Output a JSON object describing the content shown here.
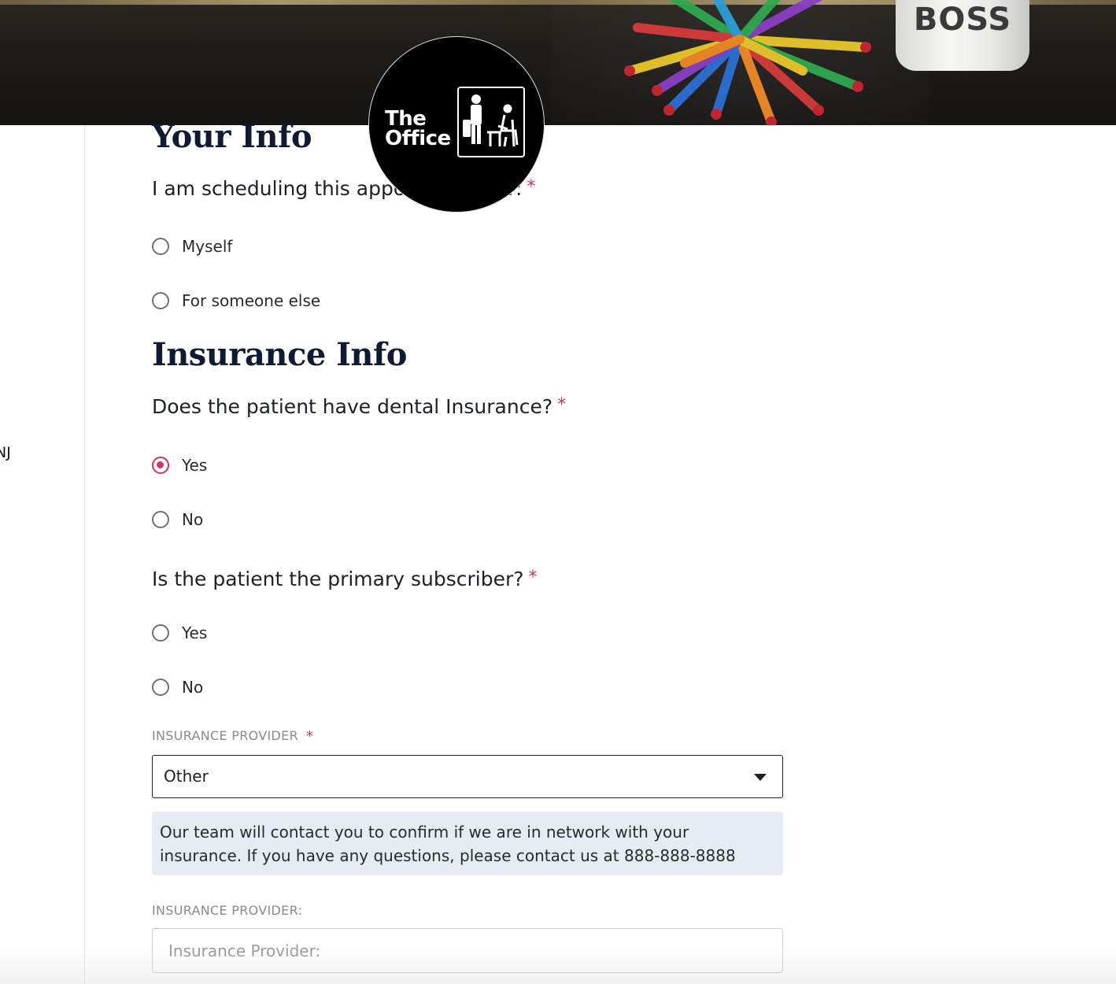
{
  "banner": {
    "mug_text": "BOSS"
  },
  "logo": {
    "line1": "The",
    "line2": "Office"
  },
  "sidebar": {
    "partial_text": "NJ"
  },
  "your_info": {
    "heading": "Your Info",
    "question": "I am scheduling this appointment for:",
    "required_mark": "*",
    "options": [
      {
        "label": "Myself",
        "checked": false
      },
      {
        "label": "For someone else",
        "checked": false
      }
    ]
  },
  "insurance_info": {
    "heading": "Insurance Info",
    "has_insurance": {
      "question": "Does the patient have dental Insurance?",
      "required_mark": "*",
      "options": [
        {
          "label": "Yes",
          "checked": true
        },
        {
          "label": "No",
          "checked": false
        }
      ]
    },
    "primary_subscriber": {
      "question": "Is the patient the primary subscriber?",
      "required_mark": "*",
      "options": [
        {
          "label": "Yes",
          "checked": false
        },
        {
          "label": "No",
          "checked": false
        }
      ]
    },
    "provider_select": {
      "label": "INSURANCE PROVIDER",
      "required_mark": "*",
      "value": "Other"
    },
    "note": "Our team will contact you to confirm if we are in network with your insurance. If you have any questions, please contact us at 888-888-8888",
    "provider_input": {
      "label": "INSURANCE PROVIDER:",
      "placeholder": "Insurance Provider:",
      "value": ""
    }
  },
  "colors": {
    "accent": "#d0365f",
    "heading": "#0f1a33",
    "note_bg": "#e7ebf3"
  }
}
